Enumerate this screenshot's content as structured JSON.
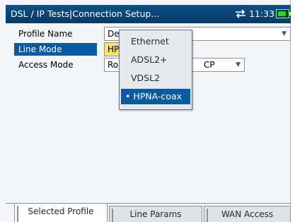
{
  "titlebar": {
    "title": "DSL / IP Tests|Connection Setup...",
    "time": "11:33",
    "signal_icon": "network-activity-icon",
    "battery_icon": "battery-icon"
  },
  "form": {
    "profile_name": {
      "label": "Profile Name",
      "value": "Def"
    },
    "line_mode": {
      "label": "Line Mode",
      "value": "HPN"
    },
    "access_mode": {
      "label": "Access Mode",
      "value": "Rou",
      "value_suffix": "CP"
    }
  },
  "line_mode_popup": {
    "options": [
      "Ethernet",
      "ADSL2+",
      "VDSL2",
      "• HPNA-coax"
    ],
    "selected_index": 3
  },
  "tabs": [
    "Selected Profile",
    "Line Params",
    "WAN Access"
  ],
  "colors": {
    "titlebar": "#0a4a82",
    "selection": "#0a5aa2",
    "highlight_value": "#f6e079"
  }
}
